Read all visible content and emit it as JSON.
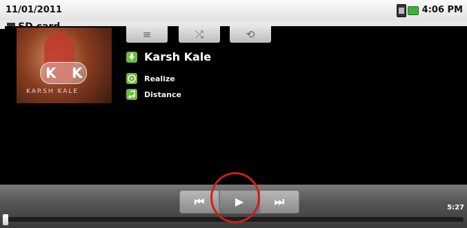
{
  "status_bar": {
    "date": "11/01/2011",
    "time": "4:06 PM",
    "icons": [
      "sd-card-icon",
      "battery-icon"
    ]
  },
  "title_bar": {
    "title": "SD card"
  },
  "album_art": {
    "icon": "album-art",
    "letters": [
      "K",
      "K"
    ],
    "caption": "KARSH KALE"
  },
  "controls": {
    "list_icon": "≡",
    "shuffle_icon": "⤮",
    "repeat_icon": "⟲"
  },
  "track": {
    "artist": "Karsh Kale",
    "album": "Realize",
    "song": "Distance"
  },
  "transport": {
    "prev_icon": "⏮",
    "play_icon": "▶",
    "next_icon": "⏭"
  },
  "playback": {
    "duration": "5:27",
    "progress_fraction": 0.0
  },
  "colors": {
    "accent_green": "#6cbb3c",
    "highlight_red": "#d41c1c"
  }
}
